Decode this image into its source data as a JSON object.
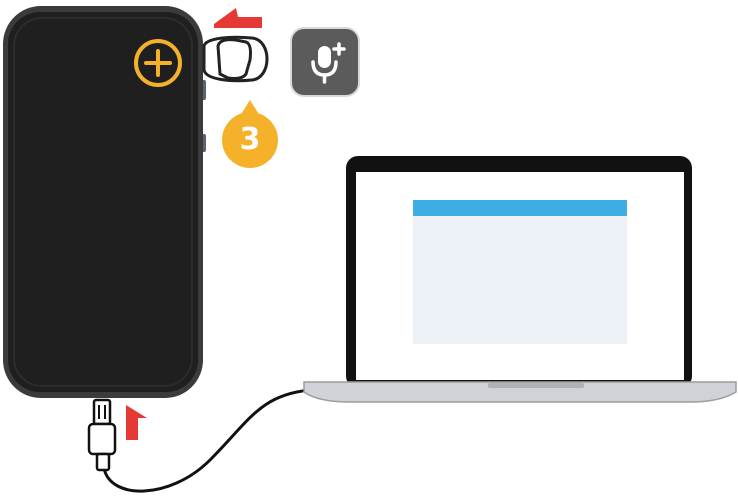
{
  "diagram": {
    "step_badge": {
      "number": "3",
      "color": "#f6b12b"
    },
    "icons": {
      "add": "plus-circle-icon",
      "voice": "microphone-plus-icon",
      "side_button": "side-button-icon"
    },
    "colors": {
      "phone_body": "#1f1f1f",
      "phone_frame": "#3b3b3b",
      "accent_add": "#f6b12b",
      "arrow": "#e53935",
      "screen_header": "#3daee3",
      "screen_window": "#edf2f9",
      "mic_tile": "#5b5b5b"
    }
  }
}
